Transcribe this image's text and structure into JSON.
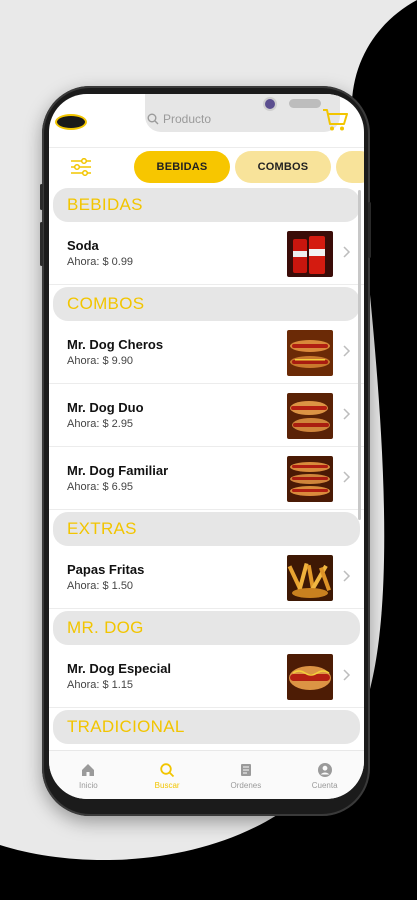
{
  "colors": {
    "accent": "#f7c600",
    "accent_light": "#f8e39a",
    "section_text": "#f2c500",
    "muted": "#9a9a9a"
  },
  "header": {
    "search_placeholder": "Producto",
    "icons": [
      "logo",
      "search-icon",
      "cart-icon"
    ]
  },
  "chips": [
    {
      "label": "BEBIDAS",
      "active": true
    },
    {
      "label": "COMBOS",
      "active": false
    }
  ],
  "sections": [
    {
      "title": "BEBIDAS",
      "items": [
        {
          "name": "Soda",
          "price": "Ahora: $ 0.99",
          "thumb": "soda"
        }
      ]
    },
    {
      "title": "COMBOS",
      "items": [
        {
          "name": "Mr. Dog Cheros",
          "price": "Ahora: $ 9.90",
          "thumb": "hotdog"
        },
        {
          "name": "Mr. Dog Duo",
          "price": "Ahora: $ 2.95",
          "thumb": "hotdog"
        },
        {
          "name": "Mr. Dog Familiar",
          "price": "Ahora: $ 6.95",
          "thumb": "hotdog"
        }
      ]
    },
    {
      "title": "EXTRAS",
      "items": [
        {
          "name": "Papas Fritas",
          "price": "Ahora: $ 1.50",
          "thumb": "fries"
        }
      ]
    },
    {
      "title": "MR. DOG",
      "items": [
        {
          "name": "Mr. Dog Especial",
          "price": "Ahora: $ 1.15",
          "thumb": "hotdog"
        }
      ]
    },
    {
      "title": "TRADICIONAL",
      "items": []
    }
  ],
  "nav": [
    {
      "label": "Inicio",
      "icon": "home-icon",
      "active": false
    },
    {
      "label": "Buscar",
      "icon": "search-icon",
      "active": true
    },
    {
      "label": "Ordenes",
      "icon": "orders-icon",
      "active": false
    },
    {
      "label": "Cuenta",
      "icon": "account-icon",
      "active": false
    }
  ]
}
